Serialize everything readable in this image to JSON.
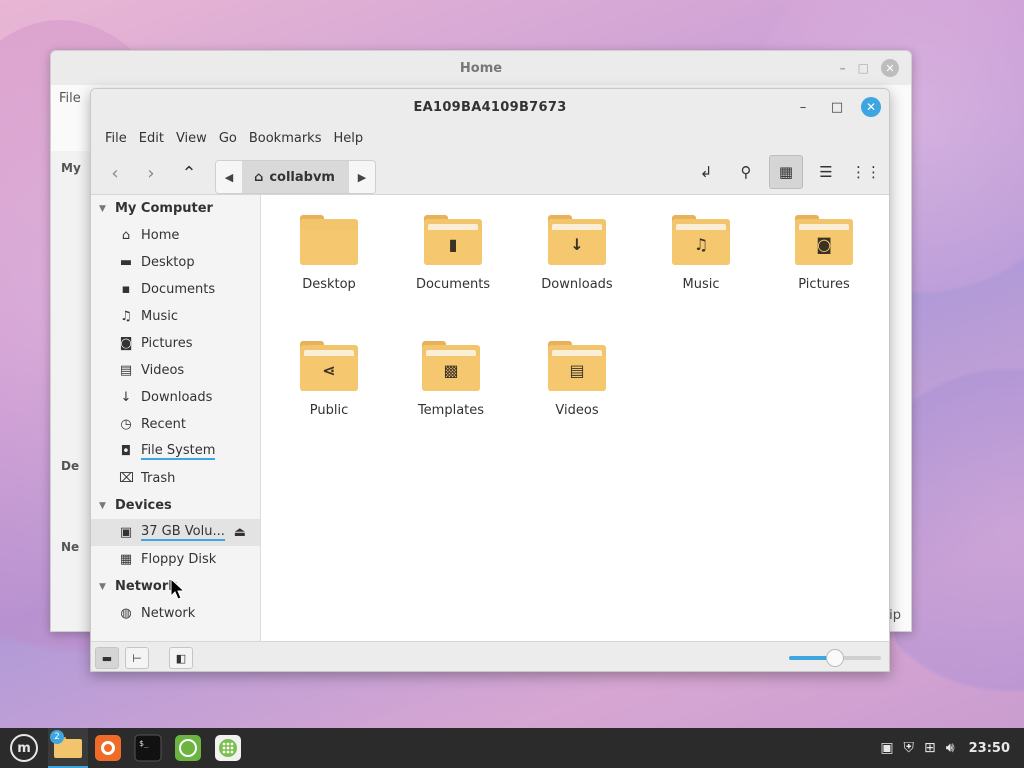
{
  "back_window": {
    "title": "Home",
    "menu_first": "File",
    "side_peek": [
      "My",
      "De",
      "Ne"
    ],
    "status_peek": "ip"
  },
  "window": {
    "title": "EA109BA4109B7673"
  },
  "menubar": [
    "File",
    "Edit",
    "View",
    "Go",
    "Bookmarks",
    "Help"
  ],
  "toolbar": {
    "back_label": "‹",
    "forward_label": "›",
    "up_label": "⌃",
    "path_crumb": "collabvm"
  },
  "sidebar": {
    "sections": [
      {
        "title": "My Computer",
        "items": [
          {
            "label": "Home",
            "icon": "home-icon",
            "glyph": "⌂"
          },
          {
            "label": "Desktop",
            "icon": "desktop-icon",
            "glyph": "▬"
          },
          {
            "label": "Documents",
            "icon": "document-icon",
            "glyph": "▪"
          },
          {
            "label": "Music",
            "icon": "music-icon",
            "glyph": "♫"
          },
          {
            "label": "Pictures",
            "icon": "camera-icon",
            "glyph": "◙"
          },
          {
            "label": "Videos",
            "icon": "film-icon",
            "glyph": "▤"
          },
          {
            "label": "Downloads",
            "icon": "download-icon",
            "glyph": "↓"
          },
          {
            "label": "Recent",
            "icon": "clock-icon",
            "glyph": "◷"
          },
          {
            "label": "File System",
            "icon": "drive-icon",
            "glyph": "◘"
          },
          {
            "label": "Trash",
            "icon": "trash-icon",
            "glyph": "⌧"
          }
        ]
      },
      {
        "title": "Devices",
        "items": [
          {
            "label": "37 GB Volu...",
            "icon": "disk-icon",
            "glyph": "▣"
          },
          {
            "label": "Floppy Disk",
            "icon": "floppy-icon",
            "glyph": "▦"
          }
        ]
      },
      {
        "title": "Network",
        "items": [
          {
            "label": "Network",
            "icon": "globe-icon",
            "glyph": "◍"
          }
        ]
      }
    ]
  },
  "files": [
    {
      "label": "Desktop",
      "glyph": ""
    },
    {
      "label": "Documents",
      "glyph": "▮"
    },
    {
      "label": "Downloads",
      "glyph": "↓"
    },
    {
      "label": "Music",
      "glyph": "♫"
    },
    {
      "label": "Pictures",
      "glyph": "◙"
    },
    {
      "label": "Public",
      "glyph": "⋖"
    },
    {
      "label": "Templates",
      "glyph": "▩"
    },
    {
      "label": "Videos",
      "glyph": "▤"
    }
  ],
  "statusbar": {
    "zoom_level": 0.5
  },
  "taskbar": {
    "badge_count": "2",
    "clock": "23:50",
    "accent": "#3da5e0"
  }
}
